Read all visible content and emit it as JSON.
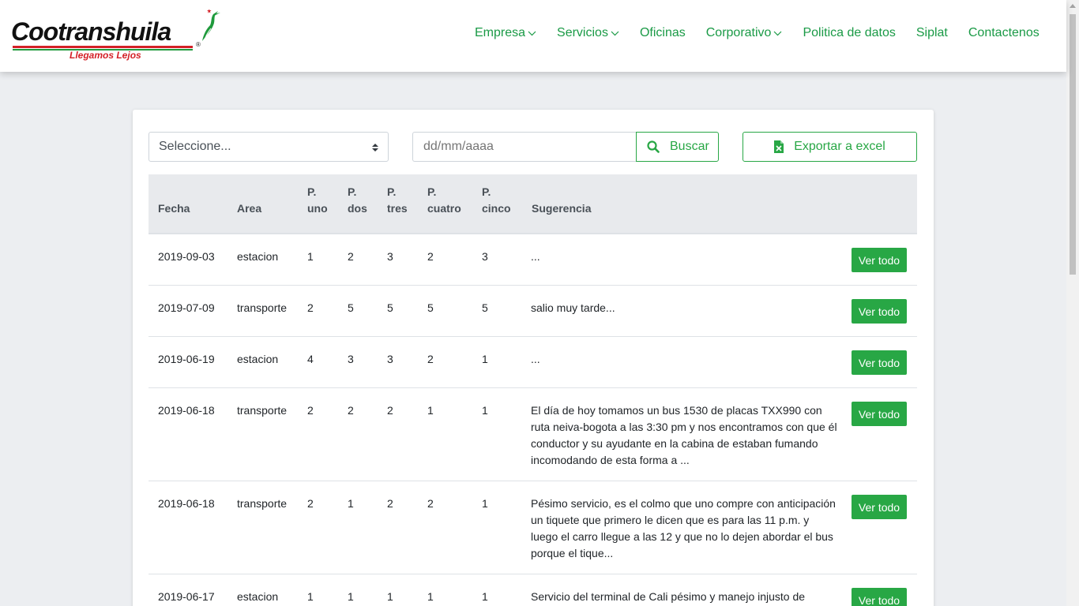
{
  "brand": {
    "name": "Cootranshuila",
    "slogan": "Llegamos Lejos",
    "registered": "®",
    "colors": {
      "green": "#1a9a46",
      "red": "#d42027",
      "button_green": "#28a745"
    }
  },
  "nav": {
    "items": [
      {
        "label": "Empresa",
        "dropdown": true
      },
      {
        "label": "Servicios",
        "dropdown": true
      },
      {
        "label": "Oficinas",
        "dropdown": false
      },
      {
        "label": "Corporativo",
        "dropdown": true
      },
      {
        "label": "Politica de datos",
        "dropdown": false
      },
      {
        "label": "Siplat",
        "dropdown": false
      },
      {
        "label": "Contactenos",
        "dropdown": false
      }
    ]
  },
  "filters": {
    "select_value": "Seleccione...",
    "date_placeholder": "dd/mm/aaaa",
    "search_label": "Buscar",
    "export_label": "Exportar a excel"
  },
  "table": {
    "headers": {
      "fecha": "Fecha",
      "area": "Area",
      "p1_a": "P.",
      "p1_b": "uno",
      "p2_a": "P.",
      "p2_b": "dos",
      "p3_a": "P.",
      "p3_b": "tres",
      "p4_a": "P.",
      "p4_b": "cuatro",
      "p5_a": "P.",
      "p5_b": "cinco",
      "sugerencia": "Sugerencia"
    },
    "action_label": "Ver todo",
    "rows": [
      {
        "fecha": "2019-09-03",
        "area": "estacion",
        "p1": "1",
        "p2": "2",
        "p3": "3",
        "p4": "2",
        "p5": "3",
        "sugerencia": "..."
      },
      {
        "fecha": "2019-07-09",
        "area": "transporte",
        "p1": "2",
        "p2": "5",
        "p3": "5",
        "p4": "5",
        "p5": "5",
        "sugerencia": "salio muy tarde..."
      },
      {
        "fecha": "2019-06-19",
        "area": "estacion",
        "p1": "4",
        "p2": "3",
        "p3": "3",
        "p4": "2",
        "p5": "1",
        "sugerencia": "..."
      },
      {
        "fecha": "2019-06-18",
        "area": "transporte",
        "p1": "2",
        "p2": "2",
        "p3": "2",
        "p4": "1",
        "p5": "1",
        "sugerencia": "El día de hoy tomamos un bus 1530 de placas TXX990 con ruta neiva-bogota a las 3:30 pm y nos encontramos con que él conductor y su ayudante en la cabina de estaban fumando incomodando de esta forma a ..."
      },
      {
        "fecha": "2019-06-18",
        "area": "transporte",
        "p1": "2",
        "p2": "1",
        "p3": "2",
        "p4": "2",
        "p5": "1",
        "sugerencia": "Pésimo servicio, es el colmo que uno compre con anticipación un tiquete que primero le dicen que es para las 11 p.m. y luego el carro llegue a las 12 y que no lo dejen abordar el bus porque el tique..."
      },
      {
        "fecha": "2019-06-17",
        "area": "estacion",
        "p1": "1",
        "p2": "1",
        "p3": "1",
        "p4": "1",
        "p5": "1",
        "sugerencia": "Servicio del terminal de Cali pésimo y manejo injusto de"
      }
    ]
  }
}
